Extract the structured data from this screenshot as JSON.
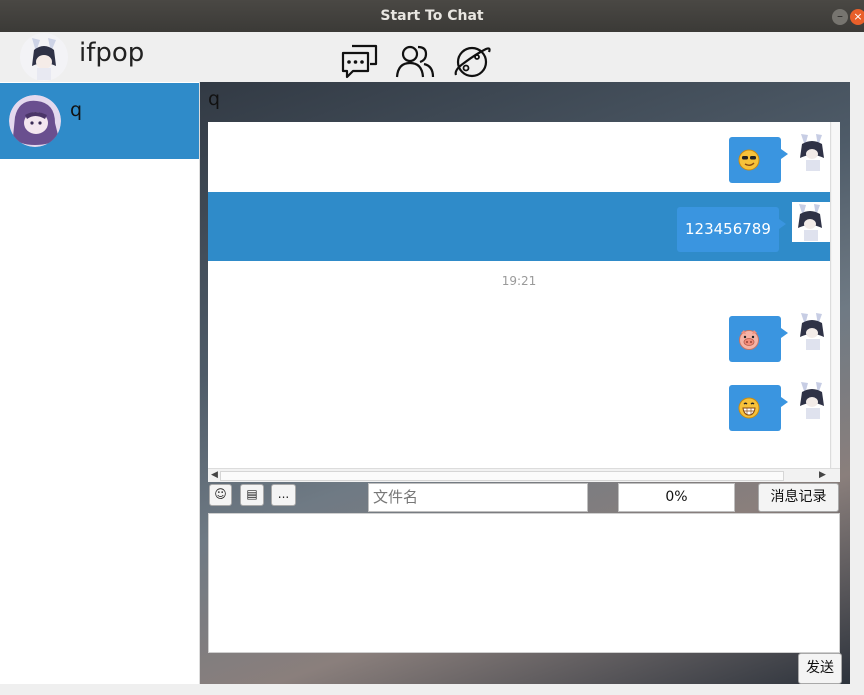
{
  "window": {
    "title": "Start To Chat"
  },
  "profile": {
    "username": "ifpop"
  },
  "nav": {
    "icons": [
      "chat-bubbles-icon",
      "contacts-icon",
      "planet-icon"
    ]
  },
  "contacts": [
    {
      "name": "q",
      "selected": true
    }
  ],
  "chat": {
    "title": "q",
    "messages": [
      {
        "type": "emoji",
        "emoji": "cool-sunglasses-emoji",
        "text": ""
      },
      {
        "type": "text",
        "text": "123456789",
        "selected": true
      },
      {
        "type": "emoji",
        "emoji": "pig-face-emoji",
        "text": ""
      },
      {
        "type": "emoji",
        "emoji": "grinning-emoji",
        "text": ""
      }
    ],
    "timestamp": "19:21"
  },
  "toolbar": {
    "emoji_label": "☺",
    "file_label": "▤",
    "more_label": "...",
    "filename_placeholder": "文件名",
    "progress": "0%",
    "history_label": "消息记录"
  },
  "composer": {
    "send_label": "发送"
  },
  "colors": {
    "accent": "#2f8bc9",
    "bubble": "#3a95e0",
    "close": "#e85f2a"
  }
}
